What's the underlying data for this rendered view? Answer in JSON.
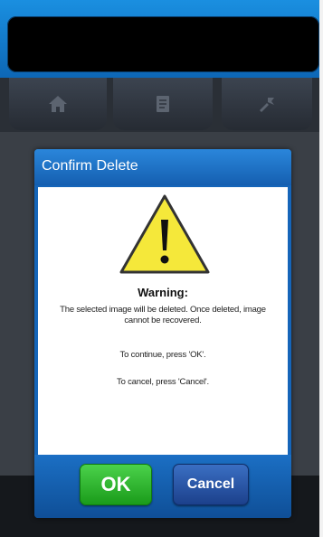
{
  "dialog": {
    "title": "Confirm Delete",
    "icon": "warning-triangle-icon",
    "heading": "Warning:",
    "message": "The selected image will be deleted. Once deleted, image cannot be recovered.",
    "continue_text": "To continue, press 'OK'.",
    "cancel_text": "To cancel, press 'Cancel'.",
    "ok_label": "OK",
    "cancel_label": "Cancel"
  },
  "tabs": [
    {
      "icon": "home-icon"
    },
    {
      "icon": "document-icon"
    },
    {
      "icon": "tools-icon"
    }
  ],
  "colors": {
    "accent": "#1565b9",
    "ok": "#2bb52b",
    "warning": "#f5e83a"
  }
}
